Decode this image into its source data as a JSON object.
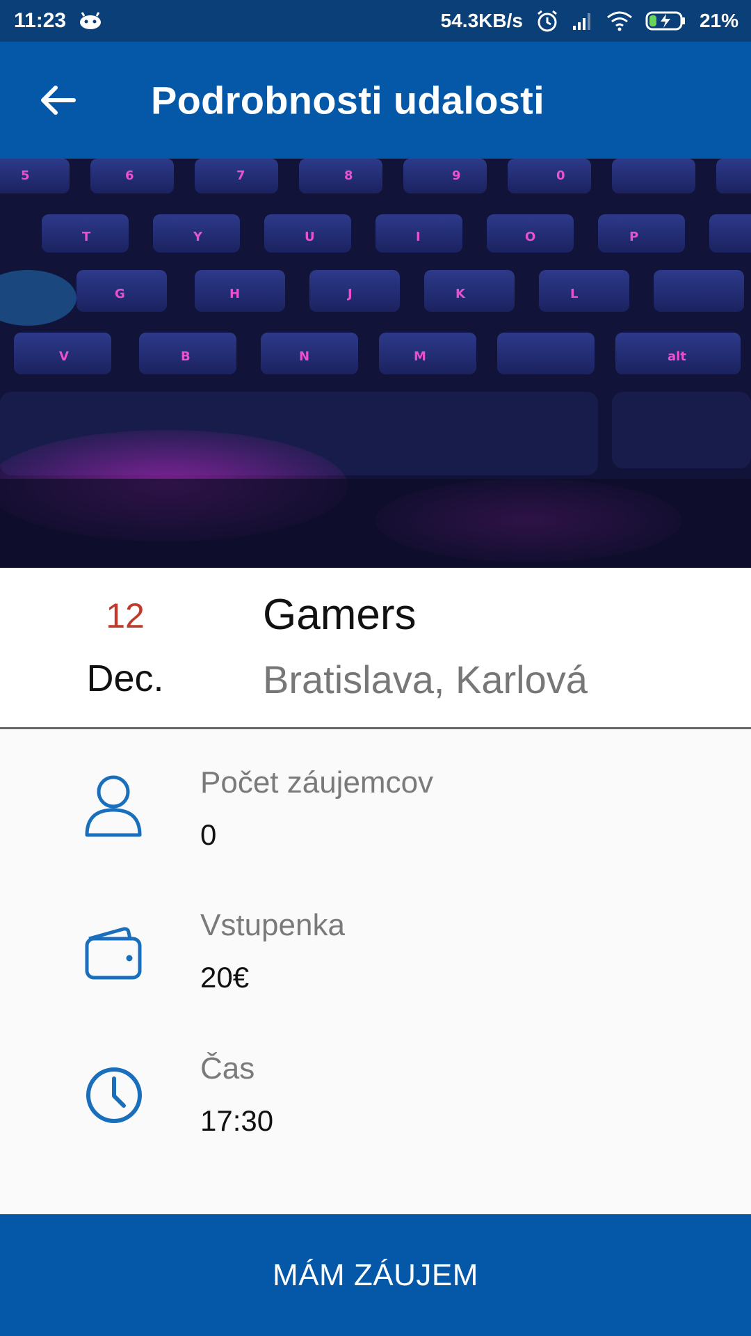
{
  "status_bar": {
    "time": "11:23",
    "network_speed": "54.3KB/s",
    "battery": "21%",
    "icons": [
      "android-icon",
      "alarm-icon",
      "signal-icon",
      "wifi-icon",
      "battery-charging-icon"
    ]
  },
  "app_bar": {
    "title": "Podrobnosti udalosti",
    "back_icon": "arrow-left-icon"
  },
  "hero": {
    "image_content": "backlit-keyboard-photo"
  },
  "event": {
    "day": "12",
    "month": "Dec.",
    "name": "Gamers",
    "location": "Bratislava, Karlová"
  },
  "details": [
    {
      "icon": "person-icon",
      "label": "Počet záujemcov",
      "value": "0"
    },
    {
      "icon": "wallet-icon",
      "label": "Vstupenka",
      "value": "20€"
    },
    {
      "icon": "clock-icon",
      "label": "Čas",
      "value": "17:30"
    }
  ],
  "cta": {
    "label": "MÁM ZÁUJEM"
  },
  "colors": {
    "primary": "#0558a8",
    "status_bar": "#0a3f78",
    "day_accent": "#c0392b",
    "icon_blue": "#1a6fbd"
  }
}
